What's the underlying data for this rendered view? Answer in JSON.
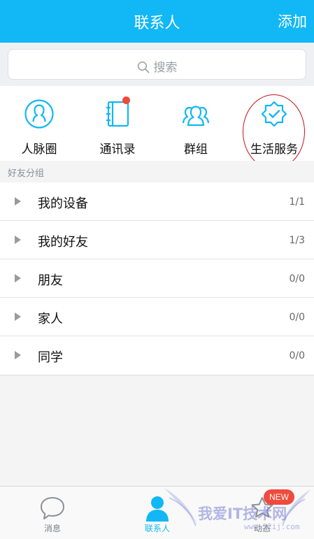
{
  "header": {
    "title": "联系人",
    "add_label": "添加"
  },
  "search": {
    "placeholder": "搜索"
  },
  "quick_actions": [
    {
      "label": "人脉圈",
      "icon": "person-circle-icon"
    },
    {
      "label": "通讯录",
      "icon": "address-book-icon",
      "has_unread_dot": true
    },
    {
      "label": "群组",
      "icon": "group-icon"
    },
    {
      "label": "生活服务",
      "icon": "verified-badge-icon"
    }
  ],
  "friend_groups": {
    "header": "好友分组",
    "items": [
      {
        "name": "我的设备",
        "count": "1/1"
      },
      {
        "name": "我的好友",
        "count": "1/3"
      },
      {
        "name": "朋友",
        "count": "0/0"
      },
      {
        "name": "家人",
        "count": "0/0"
      },
      {
        "name": "同学",
        "count": "0/0"
      }
    ]
  },
  "tabbar": {
    "tabs": [
      {
        "label": "消息",
        "icon": "chat-bubble-icon",
        "active": false
      },
      {
        "label": "联系人",
        "icon": "contact-person-icon",
        "active": true
      },
      {
        "label": "动态",
        "icon": "star-icon",
        "active": false,
        "badge": "NEW"
      }
    ]
  },
  "watermark": {
    "text": "我爱IT技术网",
    "url": "www.52ij.com"
  },
  "colors": {
    "accent": "#12b7f5",
    "badge_red": "#f04a3c",
    "annotation_circle": "#c4101b"
  }
}
